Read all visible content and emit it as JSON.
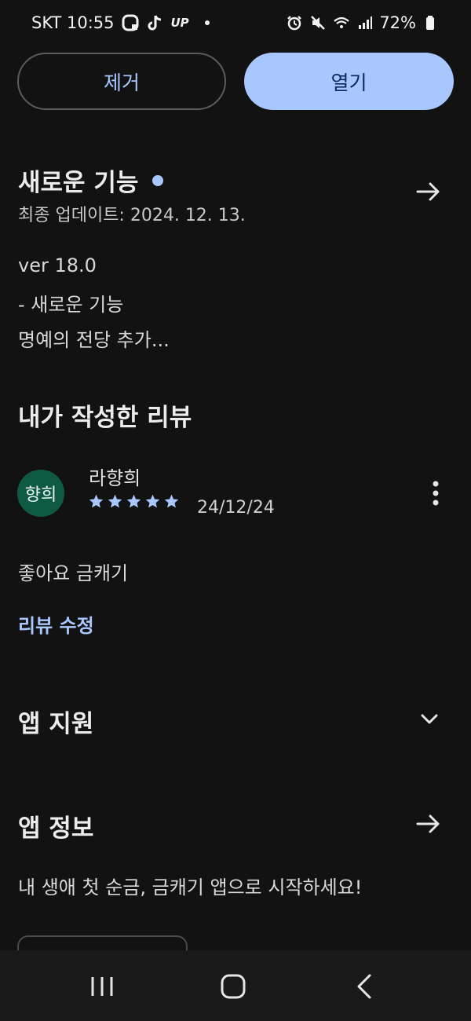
{
  "status_bar": {
    "carrier_time": "SKT 10:55",
    "up_label": "UP",
    "battery": "72%",
    "icons": [
      "chat-bubble-icon",
      "tiktok-icon",
      "up-icon",
      "notification-dot-icon",
      "alarm-icon",
      "mute-icon",
      "wifi-icon",
      "signal-icon",
      "battery-icon"
    ]
  },
  "actions": {
    "remove_label": "제거",
    "open_label": "열기"
  },
  "whats_new": {
    "title": "새로운 기능",
    "updated": "최종 업데이트: 2024. 12. 13.",
    "lines": [
      "ver 18.0",
      "- 새로운 기능",
      "명예의 전당 추가..."
    ]
  },
  "my_review": {
    "title": "내가 작성한 리뷰",
    "avatar_text": "향희",
    "reviewer": "라향희",
    "rating": 5,
    "date": "24/12/24",
    "body": "좋아요 금캐기",
    "edit_label": "리뷰 수정"
  },
  "app_support": {
    "title": "앱 지원"
  },
  "app_info": {
    "title": "앱 정보",
    "description": "내 생애 첫 순금, 금캐기 앱으로 시작하세요!"
  },
  "colors": {
    "background": "#121212",
    "accent": "#a9c7ff",
    "avatar": "#0f5a45"
  }
}
